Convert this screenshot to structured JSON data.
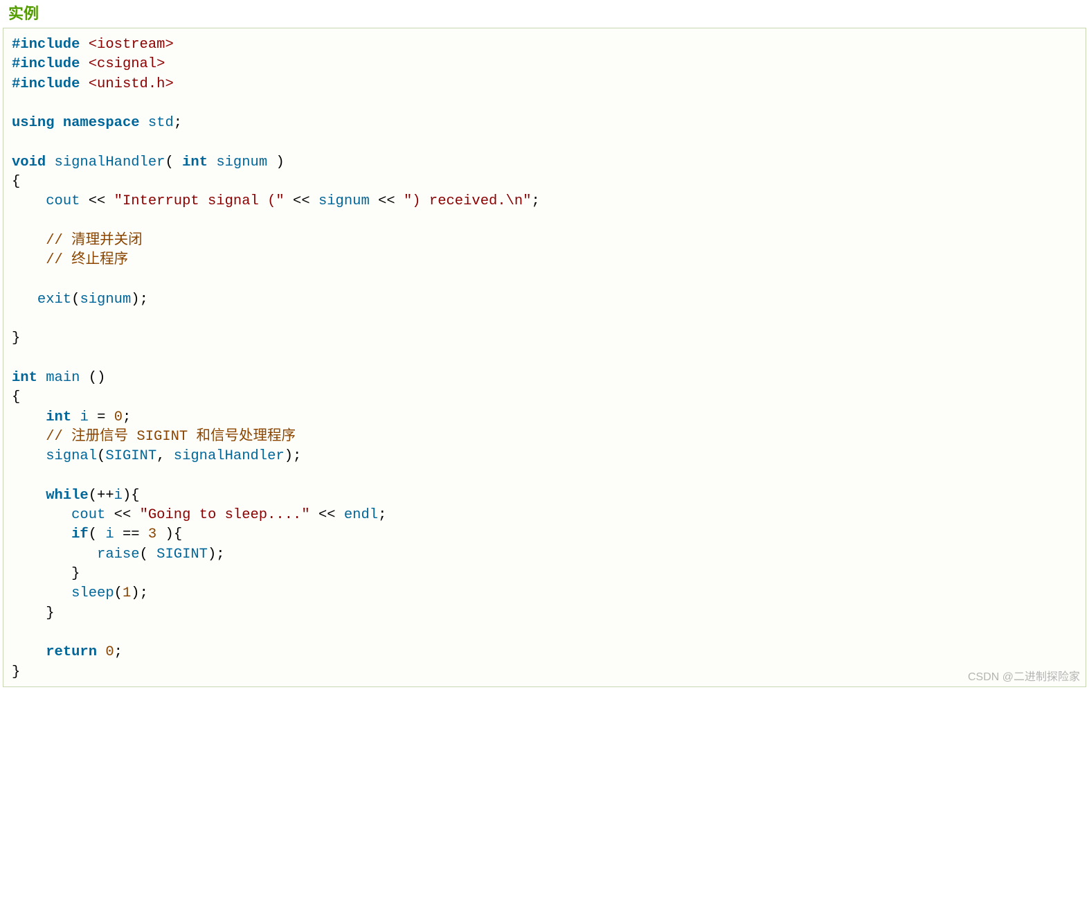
{
  "title": "实例",
  "watermark": "CSDN @二进制探险家",
  "code": {
    "inc1_kw": "#include",
    "inc1_path": "<iostream>",
    "inc2_kw": "#include",
    "inc2_path": "<csignal>",
    "inc3_kw": "#include",
    "inc3_path": "<unistd.h>",
    "using_kw": "using",
    "namespace_kw": "namespace",
    "std_name": "std",
    "semi": ";",
    "void_kw": "void",
    "fn_signalHandler": "signalHandler",
    "lparen": "(",
    "rparen": ")",
    "int_kw": "int",
    "param_signum": "signum",
    "lbrace": "{",
    "rbrace": "}",
    "cout": "cout",
    "lshift": "<<",
    "str_interrupt_open": "\"Interrupt signal (\"",
    "str_interrupt_close": "\") received.\\n\"",
    "comment_cleanup": "// 清理并关闭",
    "comment_terminate": "// 终止程序  ",
    "exit_fn": "exit",
    "main_fn": "main",
    "var_i": "i",
    "eq": "=",
    "zero": "0",
    "comment_register": "// 注册信号 SIGINT 和信号处理程序",
    "signal_fn": "signal",
    "sigint": "SIGINT",
    "comma": ",",
    "while_kw": "while",
    "plusplus": "++",
    "str_sleep": "\"Going to sleep....\"",
    "endl": "endl",
    "if_kw": "if",
    "eqeq": "==",
    "three": "3",
    "raise_fn": "raise",
    "sleep_fn": "sleep",
    "one": "1",
    "return_kw": "return"
  }
}
